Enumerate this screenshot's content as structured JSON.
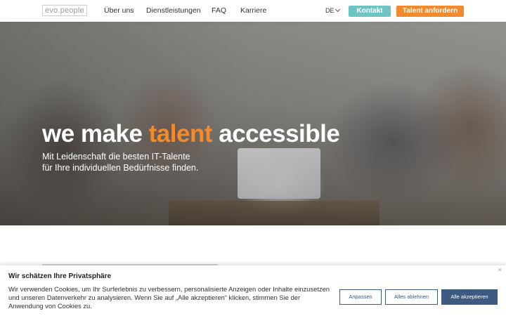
{
  "header": {
    "logo_prefix": "evo",
    "logo_dot": ".",
    "logo_suffix": "people",
    "nav": [
      "Über uns",
      "Dienstleistungen",
      "FAQ",
      "Karriere"
    ],
    "lang": "DE",
    "kontakt_label": "Kontakt",
    "talent_label": "Talent anfordern"
  },
  "hero": {
    "headline_part1": "we make ",
    "headline_accent": "talent",
    "headline_part2": " accessible",
    "subline_1": "Mit Leidenschaft die besten IT-Talente",
    "subline_2": "für Ihre individuellen Bedürfnisse finden."
  },
  "cookie": {
    "title": "Wir schätzen Ihre Privatsphäre",
    "text": "Wir verwenden Cookies, um Ihr Surferlebnis zu verbessern, personalisierte Anzeigen oder Inhalte einzusetzen und unseren Datenverkehr zu analysieren. Wenn Sie auf „Alle akzeptieren“ klicken, stimmen Sie der Anwendung von Cookies zu.",
    "customize_label": "Anpassen",
    "reject_label": "Alles ablehnen",
    "accept_label": "Alle akzeptieren",
    "close_glyph": "×"
  },
  "colors": {
    "accent_orange": "#f28a2e",
    "teal": "#6ec4c4",
    "navy": "#3d5a80"
  }
}
